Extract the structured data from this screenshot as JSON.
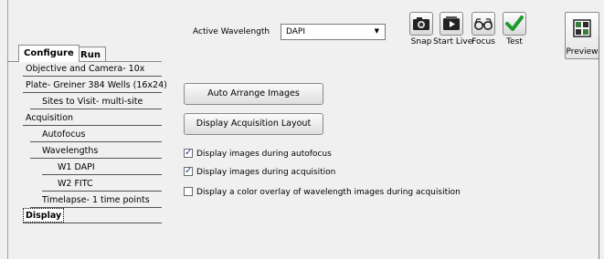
{
  "toolbar": {
    "active_wavelength_label": "Active Wavelength",
    "wavelength_value": "DAPI",
    "buttons": {
      "snap": "Snap",
      "start_live": "Start Live",
      "focus": "Focus",
      "test": "Test",
      "preview": "Preview"
    }
  },
  "tabs": {
    "configure": "Configure",
    "run": "Run"
  },
  "nav": {
    "items": [
      {
        "label": "Objective and Camera- 10x"
      },
      {
        "label": "Plate- Greiner 384 Wells (16x24)"
      },
      {
        "label": "Sites to Visit- multi-site"
      },
      {
        "label": "Acquisition"
      },
      {
        "label": "Autofocus"
      },
      {
        "label": "Wavelengths"
      },
      {
        "label": "W1 DAPI"
      },
      {
        "label": "W2 FITC"
      },
      {
        "label": "Timelapse- 1 time points"
      },
      {
        "label": "Display"
      }
    ],
    "selected": "Display"
  },
  "panel": {
    "auto_arrange_label": "Auto Arrange Images",
    "display_layout_label": "Display Acquisition Layout",
    "options": [
      {
        "label": "Display images during autofocus",
        "checked": true
      },
      {
        "label": "Display images during acquisition",
        "checked": true
      },
      {
        "label": "Display a color overlay of wavelength images during acquisition",
        "checked": false
      }
    ]
  },
  "colors": {
    "test_check": "#1f9a2e",
    "checkbox_mark": "#1a3d8f"
  }
}
